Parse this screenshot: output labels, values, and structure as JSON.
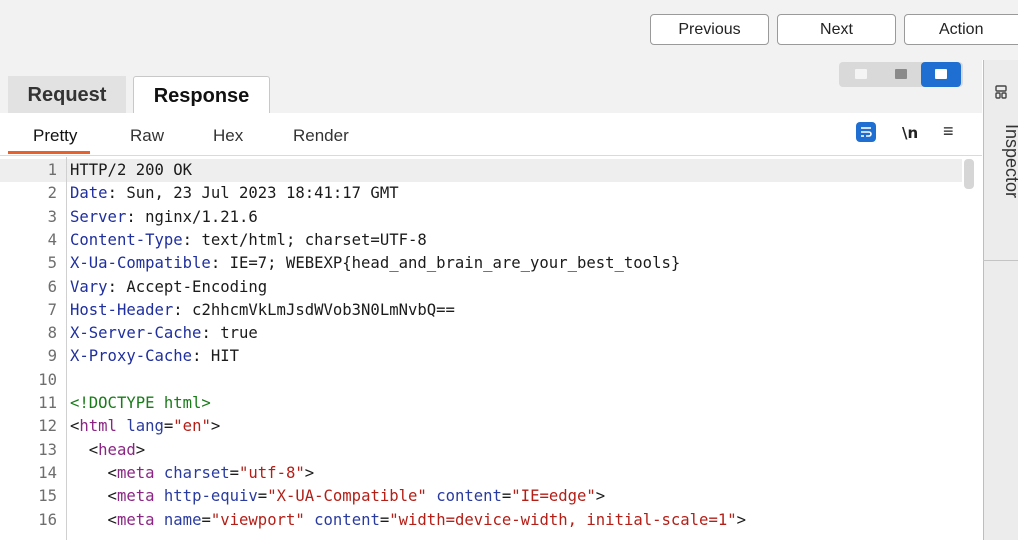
{
  "toolbar": {
    "previous_label": "Previous",
    "next_label": "Next",
    "action_label": "Action"
  },
  "tabs": {
    "request_label": "Request",
    "response_label": "Response"
  },
  "subtabs": {
    "pretty": "Pretty",
    "raw": "Raw",
    "hex": "Hex",
    "render": "Render"
  },
  "view_controls": {
    "newline_label": "\\n",
    "menu_glyph": "≡"
  },
  "inspector": {
    "label": "Inspector"
  },
  "colors": {
    "accent_orange": "#e8602c",
    "accent_blue": "#1e6fd1"
  },
  "response_lines": [
    {
      "num": "1",
      "parts": [
        [
          "HTTP/2 200 OK",
          "plain"
        ]
      ]
    },
    {
      "num": "2",
      "parts": [
        [
          "Date",
          "hdr"
        ],
        [
          ": Sun, 23 Jul 2023 18:41:17 GMT",
          "plain"
        ]
      ]
    },
    {
      "num": "3",
      "parts": [
        [
          "Server",
          "hdr"
        ],
        [
          ": nginx/1.21.6",
          "plain"
        ]
      ]
    },
    {
      "num": "4",
      "parts": [
        [
          "Content-Type",
          "hdr"
        ],
        [
          ": text/html; charset=UTF-8",
          "plain"
        ]
      ]
    },
    {
      "num": "5",
      "parts": [
        [
          "X-Ua-Compatible",
          "hdr"
        ],
        [
          ": IE=7; WEBEXP{head_and_brain_are_your_best_tools}",
          "plain"
        ]
      ]
    },
    {
      "num": "6",
      "parts": [
        [
          "Vary",
          "hdr"
        ],
        [
          ": Accept-Encoding",
          "plain"
        ]
      ]
    },
    {
      "num": "7",
      "parts": [
        [
          "Host-Header",
          "hdr"
        ],
        [
          ": c2hhcmVkLmJsdWVob3N0LmNvbQ==",
          "plain"
        ]
      ]
    },
    {
      "num": "8",
      "parts": [
        [
          "X-Server-Cache",
          "hdr"
        ],
        [
          ": true",
          "plain"
        ]
      ]
    },
    {
      "num": "9",
      "parts": [
        [
          "X-Proxy-Cache",
          "hdr"
        ],
        [
          ": HIT",
          "plain"
        ]
      ]
    },
    {
      "num": "10",
      "parts": []
    },
    {
      "num": "11",
      "parts": [
        [
          "<!DOCTYPE html>",
          "tagc"
        ]
      ]
    },
    {
      "num": "12",
      "parts": [
        [
          "<",
          "plain"
        ],
        [
          "html",
          "tag"
        ],
        [
          " ",
          "plain"
        ],
        [
          "lang",
          "attr"
        ],
        [
          "=",
          "plain"
        ],
        [
          "\"en\"",
          "val"
        ],
        [
          ">",
          "plain"
        ]
      ]
    },
    {
      "num": "13",
      "parts": [
        [
          "  <",
          "plain"
        ],
        [
          "head",
          "tag"
        ],
        [
          ">",
          "plain"
        ]
      ]
    },
    {
      "num": "14",
      "parts": [
        [
          "    <",
          "plain"
        ],
        [
          "meta",
          "tag"
        ],
        [
          " ",
          "plain"
        ],
        [
          "charset",
          "attr"
        ],
        [
          "=",
          "plain"
        ],
        [
          "\"utf-8\"",
          "val"
        ],
        [
          ">",
          "plain"
        ]
      ]
    },
    {
      "num": "15",
      "parts": [
        [
          "    <",
          "plain"
        ],
        [
          "meta",
          "tag"
        ],
        [
          " ",
          "plain"
        ],
        [
          "http-equiv",
          "attr"
        ],
        [
          "=",
          "plain"
        ],
        [
          "\"X-UA-Compatible\"",
          "val"
        ],
        [
          " ",
          "plain"
        ],
        [
          "content",
          "attr"
        ],
        [
          "=",
          "plain"
        ],
        [
          "\"IE=edge\"",
          "val"
        ],
        [
          ">",
          "plain"
        ]
      ]
    },
    {
      "num": "16",
      "parts": [
        [
          "    <",
          "plain"
        ],
        [
          "meta",
          "tag"
        ],
        [
          " ",
          "plain"
        ],
        [
          "name",
          "attr"
        ],
        [
          "=",
          "plain"
        ],
        [
          "\"viewport\"",
          "val"
        ],
        [
          " ",
          "plain"
        ],
        [
          "content",
          "attr"
        ],
        [
          "=",
          "plain"
        ],
        [
          "\"width=device-width, initial-scale=1\"",
          "val"
        ],
        [
          ">",
          "plain"
        ]
      ]
    }
  ]
}
